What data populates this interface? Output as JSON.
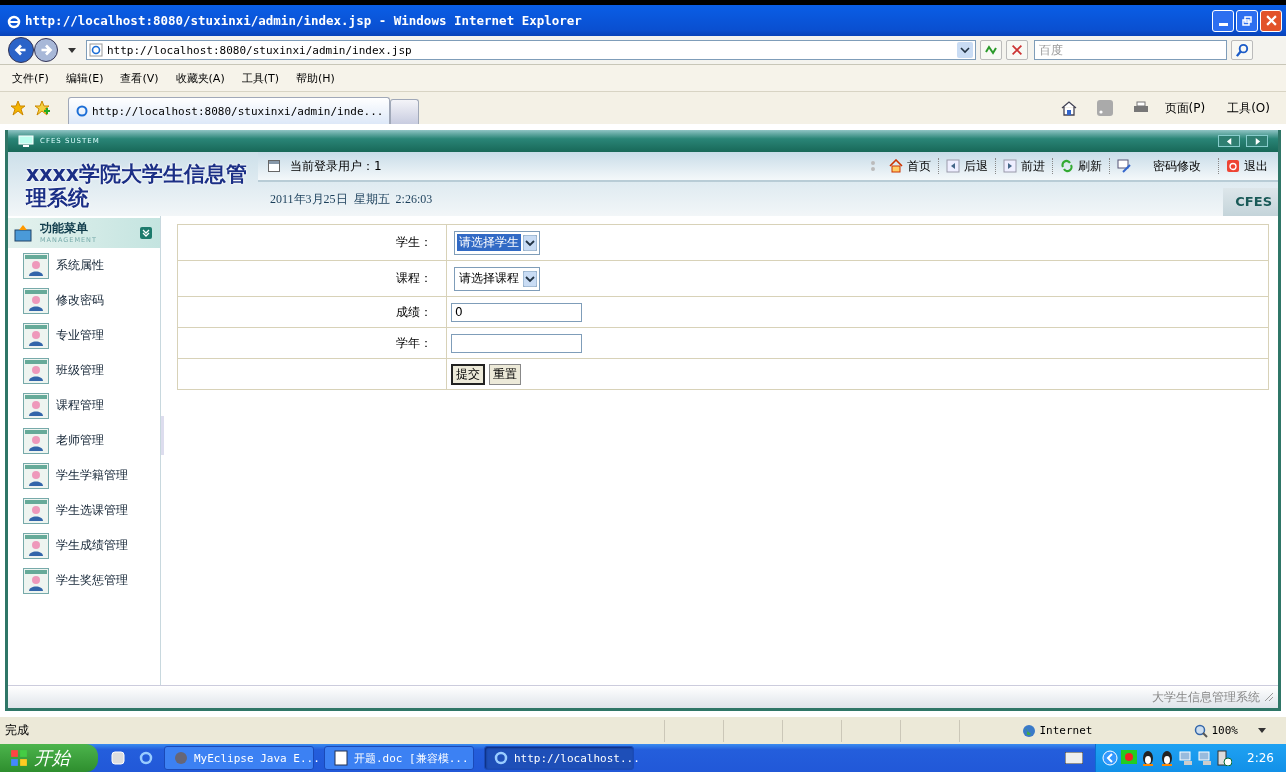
{
  "window": {
    "title": "http://localhost:8080/stuxinxi/admin/index.jsp - Windows Internet Explorer"
  },
  "address_bar": {
    "url": "http://localhost:8080/stuxinxi/admin/index.jsp",
    "search_placeholder": "百度"
  },
  "menu": [
    "文件(F)",
    "编辑(E)",
    "查看(V)",
    "收藏夹(A)",
    "工具(T)",
    "帮助(H)"
  ],
  "tab": {
    "title": "http://localhost:8080/stuxinxi/admin/inde..."
  },
  "command_bar": [
    "页面(P)",
    "工具(O)"
  ],
  "app": {
    "brand": "CFES SUSTEM",
    "title": "xxxx学院大学生信息管理系统",
    "current_user": "当前登录用户：1",
    "date": "2011年3月25日  星期五  2:26:03",
    "badge": "CFES",
    "nav": [
      {
        "label": "首页",
        "kind": "home"
      },
      {
        "label": "后退",
        "kind": "back"
      },
      {
        "label": "前进",
        "kind": "forward"
      },
      {
        "label": "刷新",
        "kind": "refresh"
      },
      {
        "label": "密码修改",
        "kind": "edit"
      },
      {
        "label": "退出",
        "kind": "exit"
      }
    ],
    "sidebar": {
      "title": "功能菜单",
      "subtitle": "MANAGEMENT",
      "items": [
        "系统属性",
        "修改密码",
        "专业管理",
        "班级管理",
        "课程管理",
        "老师管理",
        "学生学籍管理",
        "学生选课管理",
        "学生成绩管理",
        "学生奖惩管理"
      ]
    },
    "form": [
      {
        "label": "学生：",
        "kind": "select",
        "value": "请选择学生",
        "focused": true
      },
      {
        "label": "课程：",
        "kind": "select",
        "value": "请选择课程",
        "focused": false
      },
      {
        "label": "成绩：",
        "kind": "input",
        "value": "0"
      },
      {
        "label": "学年：",
        "kind": "input"
      },
      {
        "kind": "buttons",
        "buttons": [
          "提交",
          "重置"
        ]
      }
    ],
    "footer": "大学生信息管理系统"
  },
  "status_bar": {
    "status": "完成",
    "zone": "Internet",
    "zoom": "100%"
  },
  "taskbar": {
    "start": "开始",
    "tasks": [
      {
        "label": "MyEclipse Java E...",
        "kind": "eclipse",
        "selected": false
      },
      {
        "label": "开题.doc [兼容模...",
        "kind": "word",
        "selected": false
      },
      {
        "label": "http://localhost...",
        "kind": "ie",
        "selected": true
      }
    ],
    "clock": "2:26"
  }
}
